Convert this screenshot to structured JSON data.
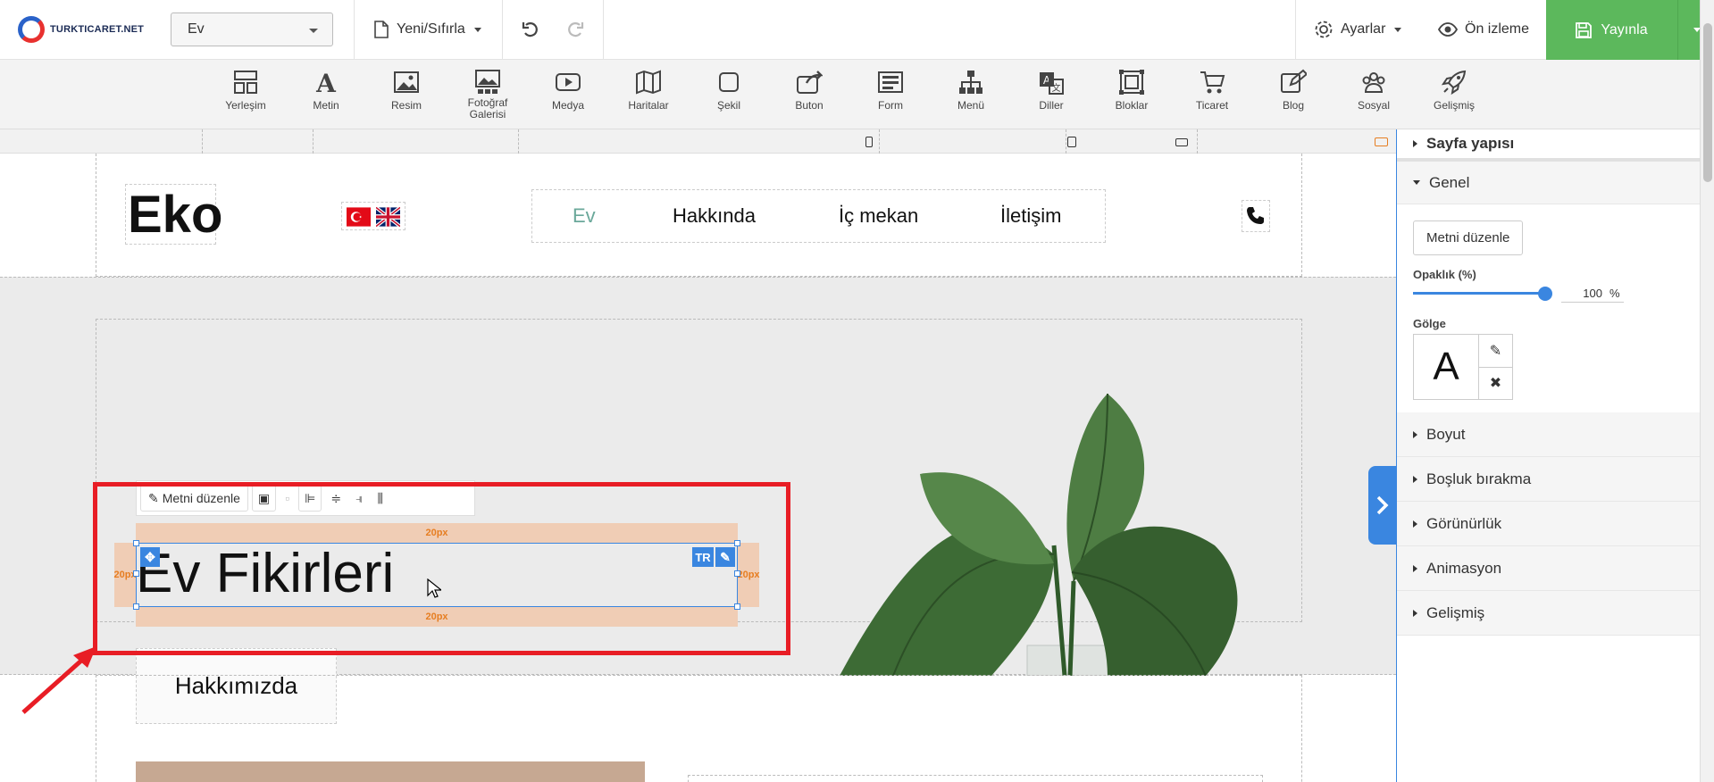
{
  "topbar": {
    "logo_text": "TURKTICARET.NET",
    "page_selector_value": "Ev",
    "reset_label": "Yeni/Sıfırla",
    "settings_label": "Ayarlar",
    "preview_label": "Ön izleme",
    "publish_label": "Yayınla"
  },
  "toolbar": {
    "items": [
      {
        "label": "Yerleşim",
        "icon": "layout-icon"
      },
      {
        "label": "Metin",
        "icon": "text-icon"
      },
      {
        "label": "Resim",
        "icon": "image-icon"
      },
      {
        "label": "Fotoğraf Galerisi",
        "icon": "gallery-icon"
      },
      {
        "label": "Medya",
        "icon": "media-icon"
      },
      {
        "label": "Haritalar",
        "icon": "map-icon"
      },
      {
        "label": "Şekil",
        "icon": "shape-icon"
      },
      {
        "label": "Buton",
        "icon": "button-icon"
      },
      {
        "label": "Form",
        "icon": "form-icon"
      },
      {
        "label": "Menü",
        "icon": "menu-icon"
      },
      {
        "label": "Diller",
        "icon": "languages-icon"
      },
      {
        "label": "Bloklar",
        "icon": "blocks-icon"
      },
      {
        "label": "Ticaret",
        "icon": "cart-icon"
      },
      {
        "label": "Blog",
        "icon": "blog-icon"
      },
      {
        "label": "Sosyal",
        "icon": "social-icon"
      },
      {
        "label": "Gelişmiş",
        "icon": "rocket-icon"
      }
    ]
  },
  "canvas": {
    "brand": "Eko",
    "nav": [
      "Ev",
      "Hakkında",
      "İç mekan",
      "İletişim"
    ],
    "nav_active_color": "#6aa89a",
    "hero_title": "Ev Fikirleri",
    "about_button": "Hakkımızda",
    "padding_label": "20px",
    "lang_badge": "TR",
    "edit_text_button": "Metni düzenle"
  },
  "panel": {
    "title": "Sayfa yapısı",
    "general": "Genel",
    "edit_text": "Metni düzenle",
    "opacity_label": "Opaklık (%)",
    "opacity_value": "100",
    "opacity_unit": "%",
    "opacity_level": 1.0,
    "shadow_label": "Gölge",
    "shadow_preview": "A",
    "sections": [
      "Boyut",
      "Boşluk bırakma",
      "Görünürlük",
      "Animasyon",
      "Gelişmiş"
    ]
  },
  "colors": {
    "accent": "#3a86e0",
    "publish": "#5cb85c",
    "highlight": "#e81d25",
    "padding": "#f0cdb5"
  }
}
